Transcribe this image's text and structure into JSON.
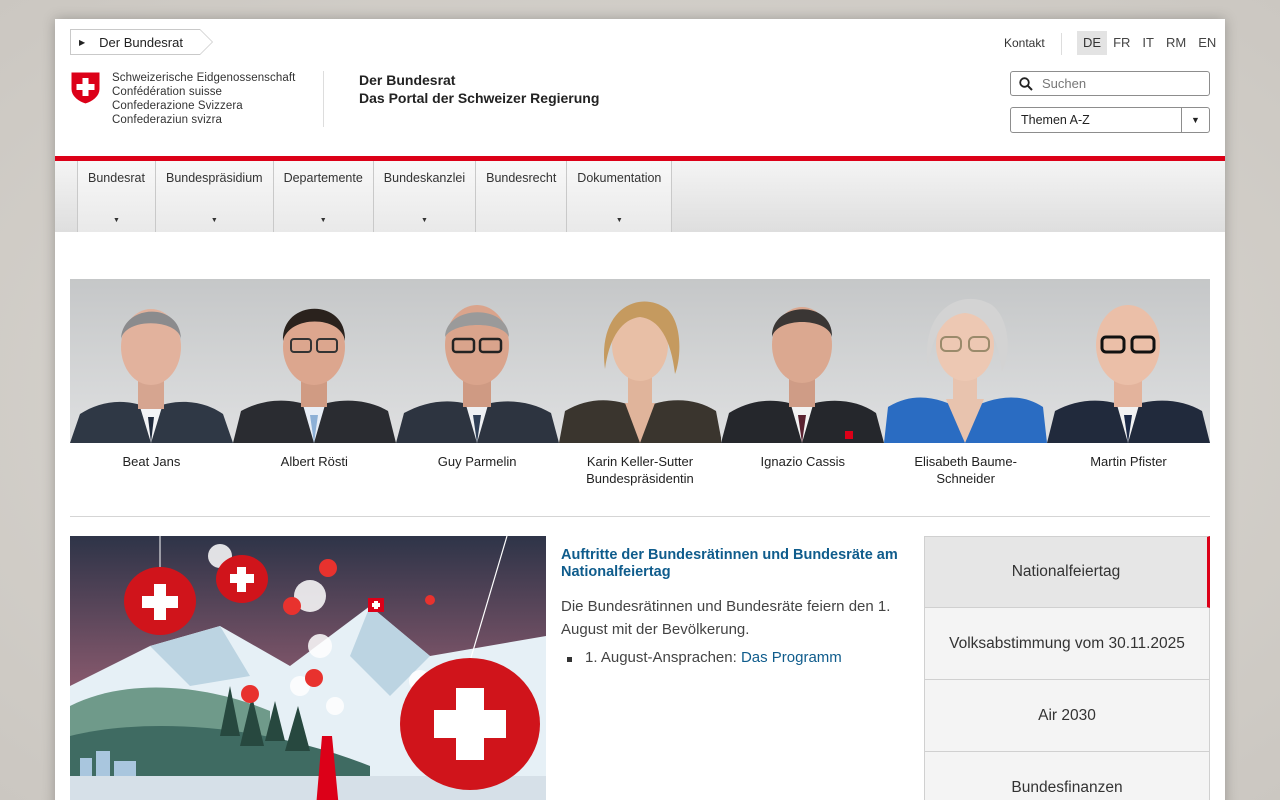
{
  "breadcrumb": {
    "label": "Der Bundesrat"
  },
  "logo": {
    "lines": [
      "Schweizerische Eidgenossenschaft",
      "Confédération suisse",
      "Confederazione Svizzera",
      "Confederaziun svizra"
    ]
  },
  "portal": {
    "line1": "Der Bundesrat",
    "line2": "Das Portal der Schweizer Regierung"
  },
  "header": {
    "kontakt": "Kontakt",
    "languages": [
      "DE",
      "FR",
      "IT",
      "RM",
      "EN"
    ],
    "active_language": "DE",
    "search_placeholder": "Suchen",
    "themes_select": "Themen A-Z"
  },
  "nav": {
    "items": [
      {
        "label": "Bundesrat",
        "has_caret": true
      },
      {
        "label": "Bundespräsidium",
        "has_caret": true
      },
      {
        "label": "Departemente",
        "has_caret": true
      },
      {
        "label": "Bundeskanzlei",
        "has_caret": true
      },
      {
        "label": "Bundesrecht",
        "has_caret": false
      },
      {
        "label": "Dokumentation",
        "has_caret": true
      }
    ]
  },
  "council": [
    {
      "name": "Beat Jans",
      "role": ""
    },
    {
      "name": "Albert Rösti",
      "role": ""
    },
    {
      "name": "Guy Parmelin",
      "role": ""
    },
    {
      "name": "Karin Keller-Sutter",
      "role": "Bundespräsidentin"
    },
    {
      "name": "Ignazio Cassis",
      "role": ""
    },
    {
      "name": "Elisabeth Baume-Schneider",
      "role": ""
    },
    {
      "name": "Martin Pfister",
      "role": ""
    }
  ],
  "article": {
    "title": "Auftritte der Bundesrätinnen und Bundesräte am Nationalfeiertag",
    "text": "Die Bundesrätinnen und Bundesräte feiern den 1. August mit der Bevölkerung.",
    "list_prefix": "1. August-Ansprachen:",
    "list_link": "Das Programm"
  },
  "topic_tabs": [
    "Nationalfeiertag",
    "Volksabstimmung vom 30.11.2025",
    "Air 2030",
    "Bundesfinanzen"
  ],
  "colors": {
    "accent_red": "#dc0018",
    "link_blue": "#0f5c8c"
  }
}
